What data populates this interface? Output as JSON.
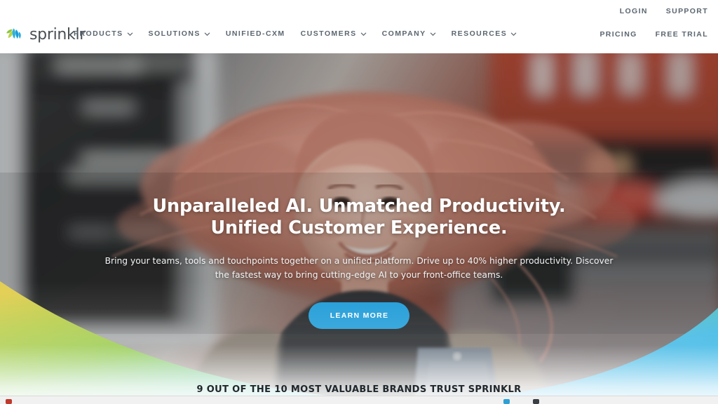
{
  "brand": {
    "name": "sprinklr",
    "logo_icon": "sprinklr-splash-logo",
    "colors": {
      "green": "#8DC63F",
      "teal": "#29ABE2",
      "blue_accent": "#1D9BD7",
      "yellow": "#D9C43E",
      "nav_text": "#5B6670"
    }
  },
  "header": {
    "utility_top": [
      {
        "label": "LOGIN",
        "name": "utility-link-login"
      },
      {
        "label": "SUPPORT",
        "name": "utility-link-support"
      }
    ],
    "utility_bottom": [
      {
        "label": "PRICING",
        "name": "utility-link-pricing"
      },
      {
        "label": "FREE TRIAL",
        "name": "utility-link-free-trial"
      }
    ],
    "nav": [
      {
        "label": "PRODUCTS",
        "has_dropdown": true
      },
      {
        "label": "SOLUTIONS",
        "has_dropdown": true
      },
      {
        "label": "UNIFIED-CXM",
        "has_dropdown": false
      },
      {
        "label": "CUSTOMERS",
        "has_dropdown": true
      },
      {
        "label": "COMPANY",
        "has_dropdown": true
      },
      {
        "label": "RESOURCES",
        "has_dropdown": true
      }
    ]
  },
  "hero": {
    "title_line1": "Unparalleled AI. Unmatched Productivity.",
    "title_line2": "Unified Customer Experience.",
    "subtitle": "Bring your teams, tools and touchpoints together on a unified platform. Drive up to 40% higher productivity. Discover the fastest way to bring cutting-edge AI to your front-office teams.",
    "cta_label": "LEARN MORE",
    "image_description": "Smiling woman with windblown reddish-blonde hair on a city street, blurred storefront at left and red brick building with parked red car at right"
  },
  "brands_banner": {
    "text": "9 OUT OF THE 10 MOST VALUABLE BRANDS TRUST SPRINKLR"
  },
  "wave": {
    "gradient_stops": [
      "#E3CE52",
      "#9ACB4B",
      "#6FC8BE",
      "#35B5E6",
      "#22AEE8"
    ]
  }
}
